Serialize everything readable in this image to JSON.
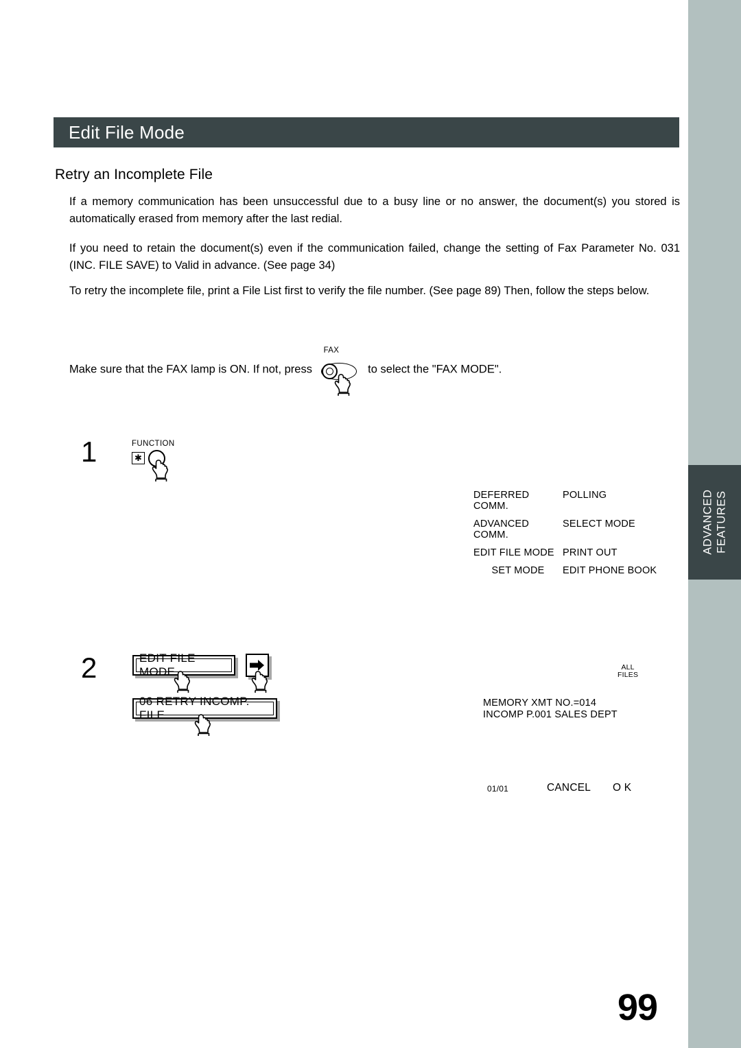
{
  "page": {
    "number": "99",
    "background_color": "#ffffff",
    "accent_color": "#3a4648",
    "edge_strip_color": "#b2c0bf"
  },
  "section_tab": {
    "line1": "ADVANCED",
    "line2": "FEATURES"
  },
  "header": {
    "title": "Edit File Mode"
  },
  "subtitle": "Retry an Incomplete File",
  "paragraphs": {
    "p1": "If a memory communication has been unsuccessful due to a busy line or no answer, the document(s) you stored is automatically erased from memory after the last redial.",
    "p2": "If you need to retain the document(s) even if the communication failed, change the setting of Fax Parameter No. 031 (INC. FILE SAVE) to Valid in advance.  (See page 34)",
    "p3": "To retry the incomplete file, print a File List first to verify the file number.  (See page 89) Then, follow the steps below."
  },
  "fax_instruction": {
    "before": "Make sure that the FAX lamp is ON.  If not, press",
    "key_label": "FAX",
    "after": "to select the \"FAX MODE\"."
  },
  "steps": [
    {
      "number": "1",
      "key_label": "FUNCTION",
      "asterisk": "✱"
    },
    {
      "number": "2",
      "button1": "EDIT FILE MODE",
      "button2": "06 RETRY INCOMP. FILE",
      "arrow_key": "▶"
    }
  ],
  "lcd_menu": {
    "rows": [
      {
        "left": "DEFERRED COMM.",
        "right": "POLLING"
      },
      {
        "left": "ADVANCED COMM.",
        "right": "SELECT MODE"
      },
      {
        "left": "EDIT FILE MODE",
        "right": "PRINT OUT"
      },
      {
        "left": "SET MODE",
        "right": "EDIT PHONE BOOK"
      }
    ]
  },
  "lcd_display": {
    "all_files_line1": "ALL",
    "all_files_line2": "FILES",
    "line1": "MEMORY XMT      NO.=014",
    "line2": "INCOMP P.001  SALES DEPT",
    "count": "01/01",
    "cancel": "CANCEL",
    "ok": "O K"
  }
}
